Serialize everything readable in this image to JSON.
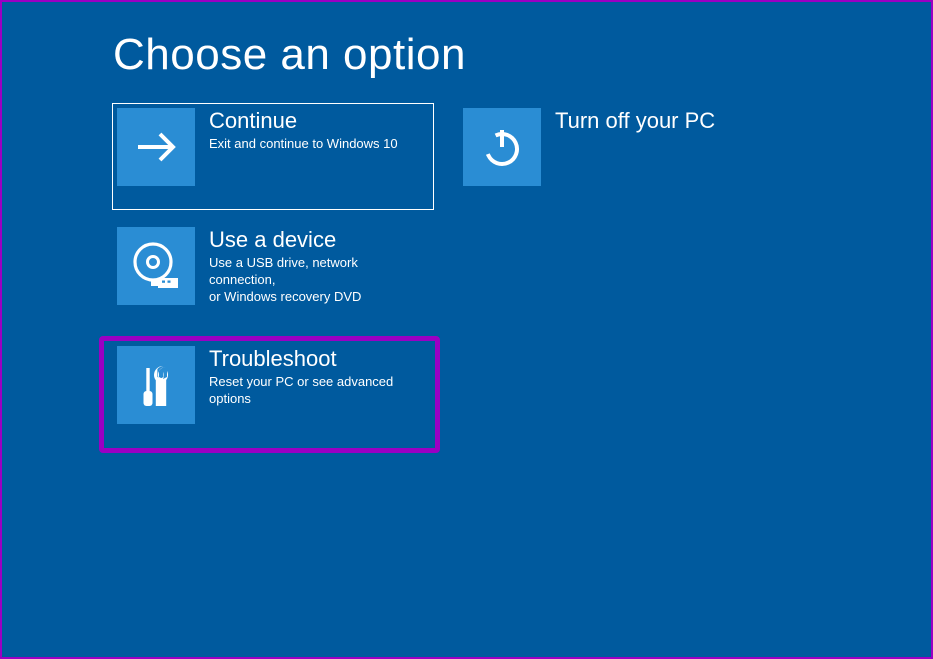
{
  "title": "Choose an option",
  "colors": {
    "background": "#005a9e",
    "icon_bg": "#2a8dd4",
    "highlight": "#9b00c3"
  },
  "left_column": [
    {
      "label": "Continue",
      "desc": "Exit and continue to Windows 10"
    },
    {
      "label": "Use a device",
      "desc": "Use a USB drive, network connection,\nor Windows recovery DVD"
    },
    {
      "label": "Troubleshoot",
      "desc": "Reset your PC or see advanced options"
    }
  ],
  "right_column": [
    {
      "label": "Turn off your PC",
      "desc": ""
    }
  ]
}
